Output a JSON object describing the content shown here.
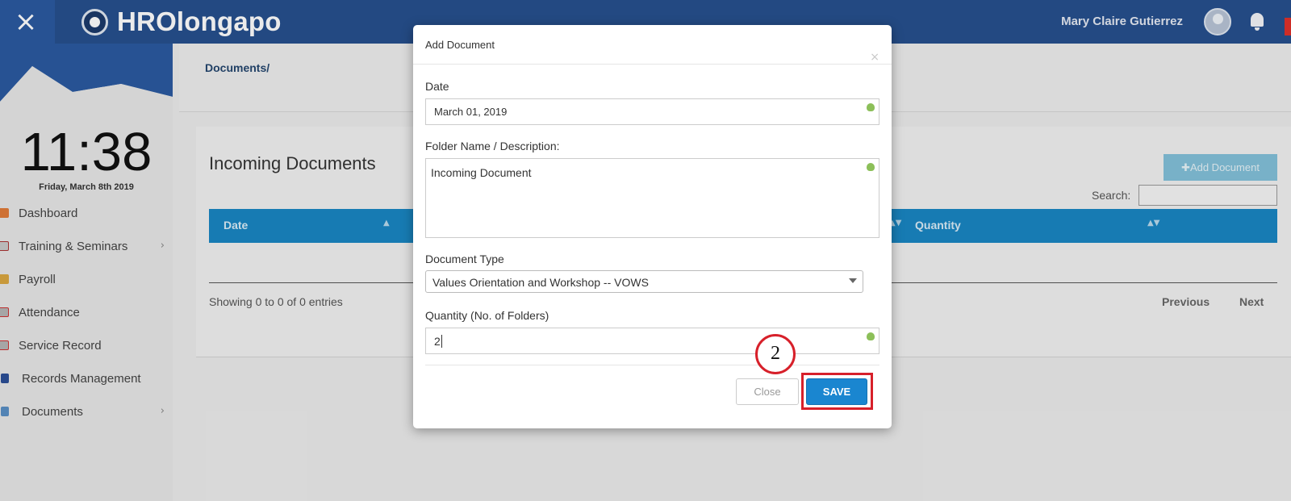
{
  "header": {
    "close_icon": "close-icon",
    "brand_name": "HROlongapo",
    "user_name": "Mary Claire Gutierrez"
  },
  "sidebar": {
    "time": "11:38",
    "date": "Friday, March 8th 2019",
    "items": [
      {
        "label": "Dashboard",
        "icon": "dashboard-icon",
        "has_submenu": false
      },
      {
        "label": "Training & Seminars",
        "icon": "calendar-icon",
        "has_submenu": true
      },
      {
        "label": "Payroll",
        "icon": "payroll-icon",
        "has_submenu": false
      },
      {
        "label": "Attendance",
        "icon": "attendance-icon",
        "has_submenu": false
      },
      {
        "label": "Service Record",
        "icon": "service-record-icon",
        "has_submenu": false
      },
      {
        "label": "Records Management",
        "icon": "records-icon",
        "has_submenu": false
      },
      {
        "label": "Documents",
        "icon": "documents-icon",
        "has_submenu": true
      }
    ]
  },
  "breadcrumb": "Documents/",
  "panel": {
    "title": "Incoming Documents",
    "add_button": "✚Add Document",
    "search_label": "Search:",
    "columns": [
      "Date",
      "Quantity"
    ],
    "entries_info": "Showing 0 to 0 of 0 entries",
    "previous": "Previous",
    "next": "Next"
  },
  "modal": {
    "title": "Add Document",
    "close_symbol": "×",
    "date_label": "Date",
    "date_value": "March 01, 2019",
    "folder_label": "Folder Name / Description:",
    "folder_value": "Incoming Document",
    "type_label": "Document Type",
    "type_value": "Values Orientation and Workshop -- VOWS",
    "quantity_label": "Quantity (No. of Folders)",
    "quantity_value": "2",
    "close_button": "Close",
    "save_button": "SAVE",
    "step_number": "2",
    "highlight_color": "#d7202a"
  },
  "colors": {
    "header": "#26508e",
    "table_header": "#1a86c3",
    "save": "#1a86d0"
  }
}
